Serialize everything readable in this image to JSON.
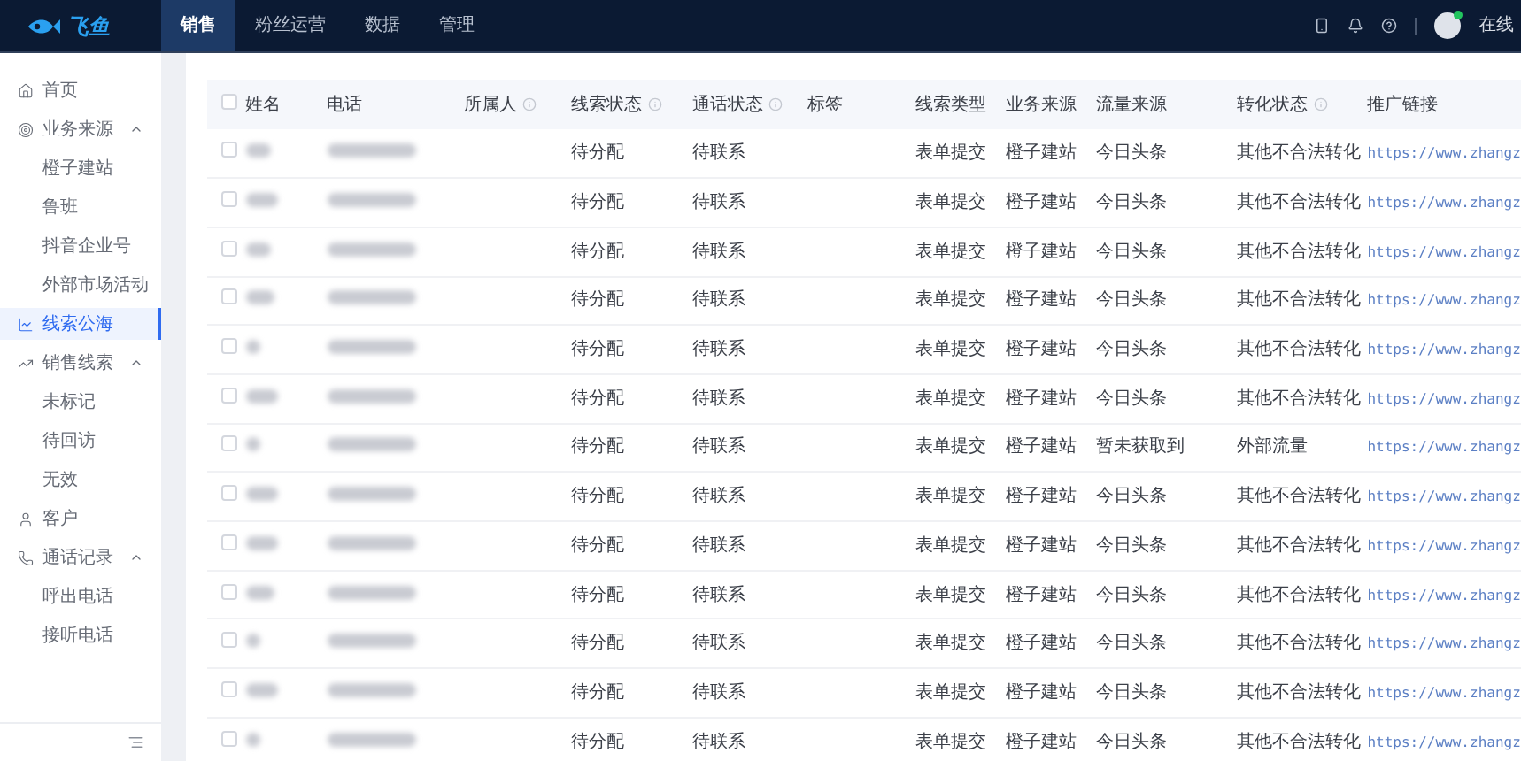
{
  "topbar": {
    "logo": "飞鱼",
    "tabs": [
      {
        "label": "销售",
        "selected": true
      },
      {
        "label": "粉丝运营",
        "selected": false
      },
      {
        "label": "数据",
        "selected": false
      },
      {
        "label": "管理",
        "selected": false
      }
    ],
    "user_status": "在线"
  },
  "sidebar": {
    "items": [
      {
        "label": "首页",
        "selected": false
      },
      {
        "label": "业务来源",
        "selected": false,
        "expanded": true,
        "children": [
          {
            "label": "橙子建站",
            "selected": false
          },
          {
            "label": "鲁班",
            "selected": false
          },
          {
            "label": "抖音企业号",
            "selected": false
          },
          {
            "label": "外部市场活动",
            "selected": false
          }
        ]
      },
      {
        "label": "线索公海",
        "selected": true
      },
      {
        "label": "销售线索",
        "selected": false,
        "expanded": true,
        "children": [
          {
            "label": "未标记",
            "selected": false
          },
          {
            "label": "待回访",
            "selected": false
          },
          {
            "label": "无效",
            "selected": false
          }
        ]
      },
      {
        "label": "客户",
        "selected": false
      },
      {
        "label": "通话记录",
        "selected": false,
        "expanded": true,
        "children": [
          {
            "label": "呼出电话",
            "selected": false
          },
          {
            "label": "接听电话",
            "selected": false
          }
        ]
      }
    ]
  },
  "table": {
    "header_checked": false,
    "columns": [
      {
        "label": "姓名",
        "info": false
      },
      {
        "label": "电话",
        "info": false
      },
      {
        "label": "所属人",
        "info": true
      },
      {
        "label": "线索状态",
        "info": true
      },
      {
        "label": "通话状态",
        "info": true
      },
      {
        "label": "标签",
        "info": false
      },
      {
        "label": "线索类型",
        "info": false
      },
      {
        "label": "业务来源",
        "info": false
      },
      {
        "label": "流量来源",
        "info": false
      },
      {
        "label": "转化状态",
        "info": true
      },
      {
        "label": "推广链接",
        "info": false
      }
    ],
    "rows": [
      {
        "checked": false,
        "status": "待分配",
        "call_status": "待联系",
        "lead_type": "表单提交",
        "biz_source": "橙子建站",
        "traffic_source": "今日头条",
        "conversion": "其他不合法转化",
        "link": "https://www.zhangz"
      },
      {
        "checked": false,
        "status": "待分配",
        "call_status": "待联系",
        "lead_type": "表单提交",
        "biz_source": "橙子建站",
        "traffic_source": "今日头条",
        "conversion": "其他不合法转化",
        "link": "https://www.zhangz"
      },
      {
        "checked": false,
        "status": "待分配",
        "call_status": "待联系",
        "lead_type": "表单提交",
        "biz_source": "橙子建站",
        "traffic_source": "今日头条",
        "conversion": "其他不合法转化",
        "link": "https://www.zhangz"
      },
      {
        "checked": false,
        "status": "待分配",
        "call_status": "待联系",
        "lead_type": "表单提交",
        "biz_source": "橙子建站",
        "traffic_source": "今日头条",
        "conversion": "其他不合法转化",
        "link": "https://www.zhangz"
      },
      {
        "checked": false,
        "status": "待分配",
        "call_status": "待联系",
        "lead_type": "表单提交",
        "biz_source": "橙子建站",
        "traffic_source": "今日头条",
        "conversion": "其他不合法转化",
        "link": "https://www.zhangz"
      },
      {
        "checked": false,
        "status": "待分配",
        "call_status": "待联系",
        "lead_type": "表单提交",
        "biz_source": "橙子建站",
        "traffic_source": "今日头条",
        "conversion": "其他不合法转化",
        "link": "https://www.zhangz"
      },
      {
        "checked": false,
        "status": "待分配",
        "call_status": "待联系",
        "lead_type": "表单提交",
        "biz_source": "橙子建站",
        "traffic_source": "暂未获取到",
        "conversion": "外部流量",
        "link": "https://www.zhangz"
      },
      {
        "checked": false,
        "status": "待分配",
        "call_status": "待联系",
        "lead_type": "表单提交",
        "biz_source": "橙子建站",
        "traffic_source": "今日头条",
        "conversion": "其他不合法转化",
        "link": "https://www.zhangz"
      },
      {
        "checked": false,
        "status": "待分配",
        "call_status": "待联系",
        "lead_type": "表单提交",
        "biz_source": "橙子建站",
        "traffic_source": "今日头条",
        "conversion": "其他不合法转化",
        "link": "https://www.zhangz"
      },
      {
        "checked": false,
        "status": "待分配",
        "call_status": "待联系",
        "lead_type": "表单提交",
        "biz_source": "橙子建站",
        "traffic_source": "今日头条",
        "conversion": "其他不合法转化",
        "link": "https://www.zhangz"
      },
      {
        "checked": false,
        "status": "待分配",
        "call_status": "待联系",
        "lead_type": "表单提交",
        "biz_source": "橙子建站",
        "traffic_source": "今日头条",
        "conversion": "其他不合法转化",
        "link": "https://www.zhangz"
      },
      {
        "checked": false,
        "status": "待分配",
        "call_status": "待联系",
        "lead_type": "表单提交",
        "biz_source": "橙子建站",
        "traffic_source": "今日头条",
        "conversion": "其他不合法转化",
        "link": "https://www.zhangz"
      },
      {
        "checked": false,
        "status": "待分配",
        "call_status": "待联系",
        "lead_type": "表单提交",
        "biz_source": "橙子建站",
        "traffic_source": "今日头条",
        "conversion": "其他不合法转化",
        "link": "https://www.zhangz"
      }
    ]
  }
}
